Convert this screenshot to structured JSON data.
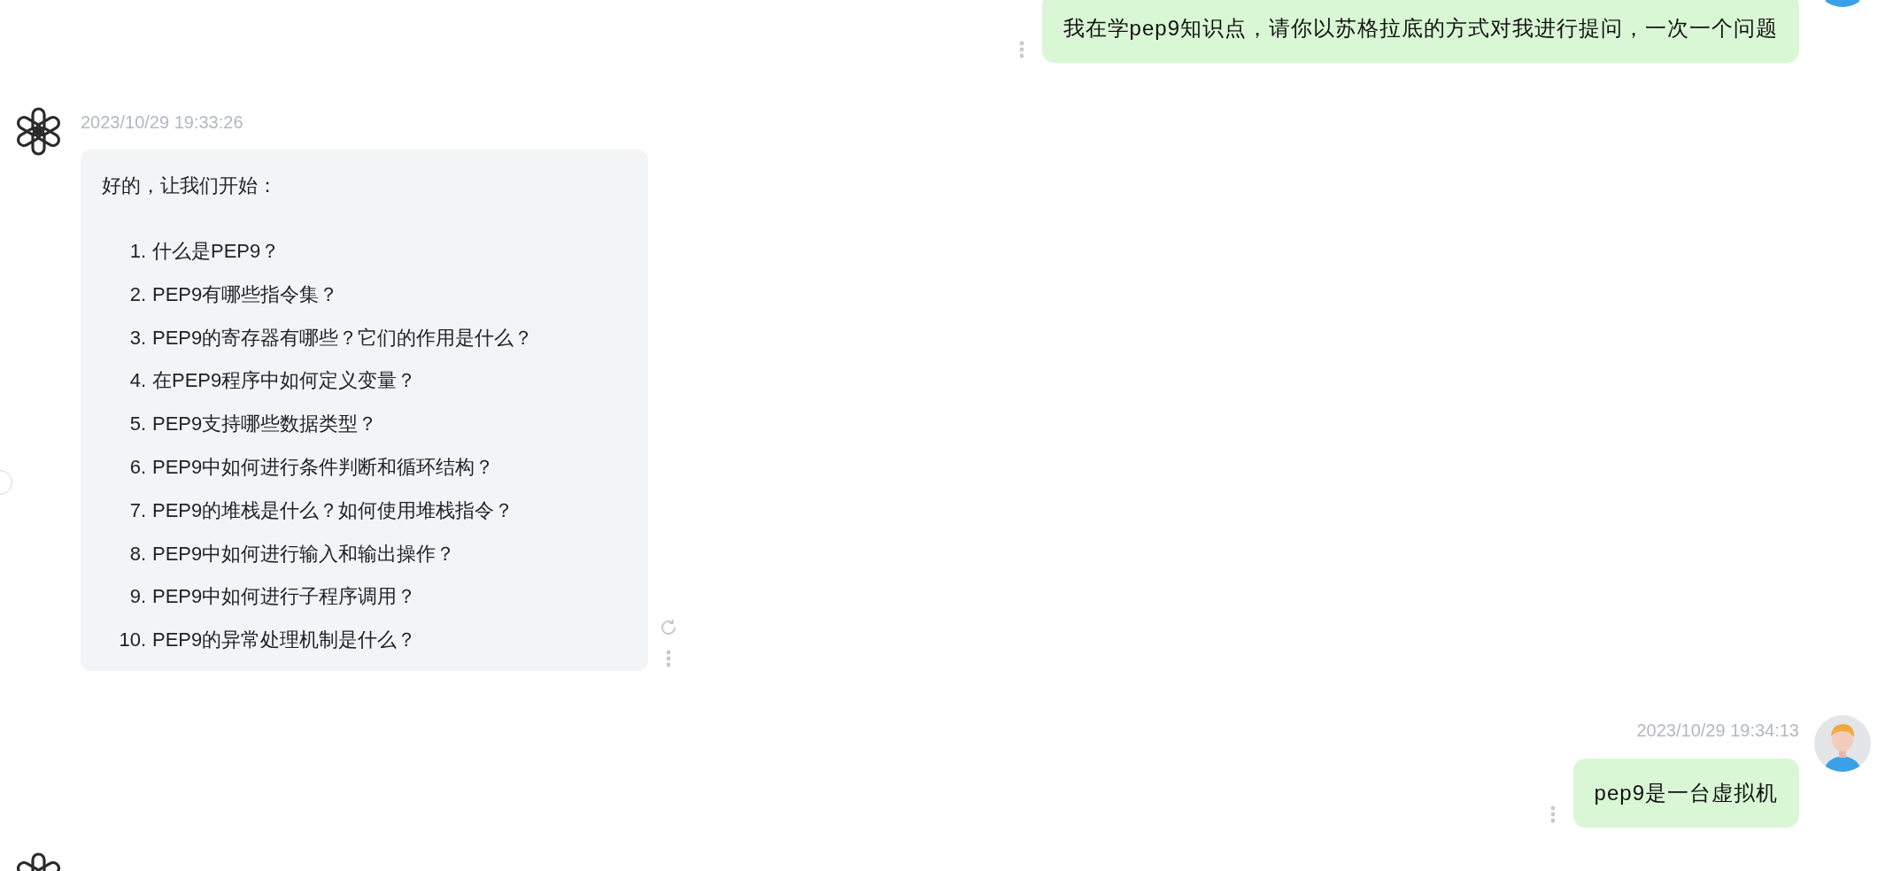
{
  "messages": [
    {
      "kind": "user",
      "text": "我在学pep9知识点，请你以苏格拉底的方式对我进行提问，一次一个问题"
    },
    {
      "kind": "assistant",
      "timestamp": "2023/10/29 19:33:26",
      "intro": "好的，让我们开始：",
      "items": [
        {
          "number": "1.",
          "text": "什么是PEP9？"
        },
        {
          "number": "2.",
          "text": "PEP9有哪些指令集？"
        },
        {
          "number": "3.",
          "text": "PEP9的寄存器有哪些？它们的作用是什么？"
        },
        {
          "number": "4.",
          "text": "在PEP9程序中如何定义变量？"
        },
        {
          "number": "5.",
          "text": "PEP9支持哪些数据类型？"
        },
        {
          "number": "6.",
          "text": "PEP9中如何进行条件判断和循环结构？"
        },
        {
          "number": "7.",
          "text": "PEP9的堆栈是什么？如何使用堆栈指令？"
        },
        {
          "number": "8.",
          "text": "PEP9中如何进行输入和输出操作？"
        },
        {
          "number": "9.",
          "text": "PEP9中如何进行子程序调用？"
        },
        {
          "number": "10.",
          "text": "PEP9的异常处理机制是什么？"
        }
      ]
    },
    {
      "kind": "user",
      "timestamp": "2023/10/29 19:34:13",
      "text": "pep9是一台虚拟机"
    },
    {
      "kind": "assistant"
    }
  ]
}
